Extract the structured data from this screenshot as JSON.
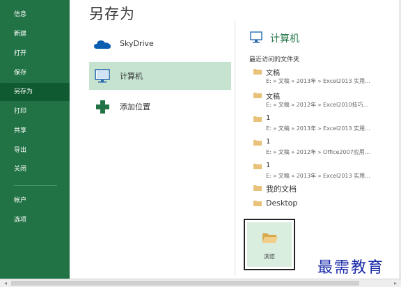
{
  "sidebar": {
    "items": [
      {
        "label": "信息"
      },
      {
        "label": "新建"
      },
      {
        "label": "打开"
      },
      {
        "label": "保存"
      },
      {
        "label": "另存为"
      },
      {
        "label": "打印"
      },
      {
        "label": "共享"
      },
      {
        "label": "导出"
      },
      {
        "label": "关闭"
      },
      {
        "label": "帐户"
      },
      {
        "label": "选项"
      }
    ],
    "selected": "另存为"
  },
  "main": {
    "title": "另存为",
    "places": [
      {
        "label": "SkyDrive",
        "icon": "cloud-icon"
      },
      {
        "label": "计算机",
        "icon": "computer-icon"
      },
      {
        "label": "添加位置",
        "icon": "plus-icon"
      }
    ],
    "selected_place": "计算机"
  },
  "computer": {
    "header": "计算机",
    "recent_title": "最近访问的文件夹",
    "folders": [
      {
        "name": "文稿",
        "path": "E: » 文稿 » 2013年 » Excel2013 实用..."
      },
      {
        "name": "文稿",
        "path": "E: » 文稿 » 2012年 » Excel2010技巧..."
      },
      {
        "name": "1",
        "path": "E: » 文稿 » 2013年 » Excel2013 实用..."
      },
      {
        "name": "1",
        "path": "E: » 文稿 » 2012年 » Office2007应用..."
      },
      {
        "name": "1",
        "path": "E: » 文稿 » 2013年 » Excel2013 实用..."
      },
      {
        "name": "我的文档",
        "path": ""
      },
      {
        "name": "Desktop",
        "path": ""
      }
    ],
    "browse_label": "浏览"
  },
  "watermark": "最需教育",
  "colors": {
    "sidebar_bg": "#217346",
    "sidebar_selected": "#0f5a30",
    "place_selected": "#c5e3cf",
    "accent": "#217346",
    "folder": "#e8c27a"
  }
}
